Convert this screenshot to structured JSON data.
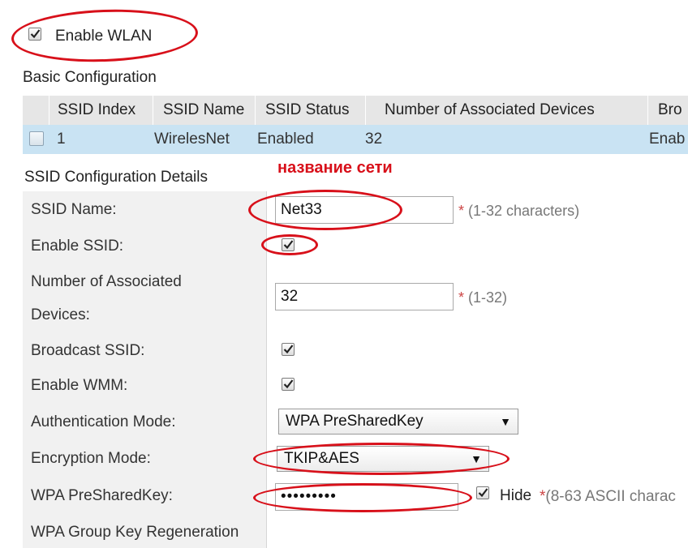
{
  "wlan": {
    "enable_label": "Enable WLAN",
    "checked": true
  },
  "basic_config": {
    "title": "Basic Configuration",
    "columns": [
      "SSID Index",
      "SSID Name",
      "SSID Status",
      "Number of Associated Devices",
      "Bro"
    ],
    "rows": [
      {
        "index": "1",
        "name": "WirelesNet",
        "status": "Enabled",
        "devices": "32",
        "broadcast": "Enab"
      }
    ]
  },
  "annotation": {
    "network_name_note": "название сети",
    "color": "#d8101a"
  },
  "details": {
    "title": "SSID Configuration Details",
    "ssid_name": {
      "label": "SSID Name:",
      "value": "Net33",
      "hint_star": "*",
      "hint": " (1-32 characters)"
    },
    "enable_ssid": {
      "label": "Enable SSID:",
      "checked": true
    },
    "num_devices": {
      "label_line1": "Number of Associated",
      "label_line2": "Devices:",
      "value": "32",
      "hint_star": "*",
      "hint": " (1-32)"
    },
    "broadcast_ssid": {
      "label": "Broadcast SSID:",
      "checked": true
    },
    "enable_wmm": {
      "label": "Enable WMM:",
      "checked": true
    },
    "auth_mode": {
      "label": "Authentication Mode:",
      "value": "WPA PreSharedKey",
      "arrow": "▼"
    },
    "encryption_mode": {
      "label": "Encryption Mode:",
      "value": "TKIP&AES",
      "arrow": "▼"
    },
    "wpa_key": {
      "label": "WPA PreSharedKey:",
      "value": "•••••••••",
      "hide_label": "Hide",
      "hide_checked": true,
      "hint_star": "*",
      "hint": "(8-63 ASCII charac"
    },
    "group_key": {
      "label": "WPA Group Key Regeneration"
    }
  }
}
